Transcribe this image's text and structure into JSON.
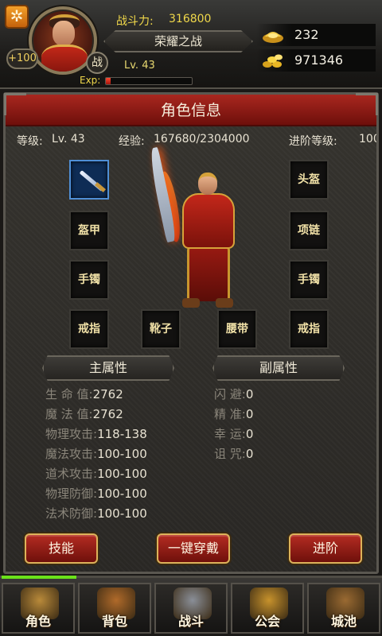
{
  "header": {
    "power_label": "战斗力:",
    "power_value": "316800",
    "title_name": "荣耀之战",
    "level": "Lv. 43",
    "level_bonus": "+100",
    "battle_badge": "战",
    "exp_label": "Exp:",
    "exp_progress": 0.06,
    "gold": "232",
    "coins": "971346",
    "settings_icon": "gear-icon",
    "gold_icon": "gold-ingot-icon",
    "coin_icon": "coin-pile-icon"
  },
  "panel": {
    "title": "角色信息",
    "level_label": "等级:",
    "level_value": "Lv. 43",
    "exp_label": "经验:",
    "exp_value": "167680/2304000",
    "advance_label": "进阶等级:",
    "advance_value": "100"
  },
  "equipment": {
    "helmet": "头盔",
    "armor": "盔甲",
    "necklace": "项链",
    "bracelet_left": "手镯",
    "bracelet_right": "手镯",
    "ring_left": "戒指",
    "boots": "靴子",
    "belt": "腰带",
    "ring_right": "戒指"
  },
  "main_attributes": {
    "title": "主属性",
    "items": [
      {
        "label": "生  命  值:",
        "value": "2762"
      },
      {
        "label": "魔  法  值:",
        "value": "2762"
      },
      {
        "label": "物理攻击:",
        "value": "118-138"
      },
      {
        "label": "魔法攻击:",
        "value": "100-100"
      },
      {
        "label": "道术攻击:",
        "value": "100-100"
      },
      {
        "label": "物理防御:",
        "value": "100-100"
      },
      {
        "label": "法术防御:",
        "value": "100-100"
      }
    ]
  },
  "sub_attributes": {
    "title": "副属性",
    "items": [
      {
        "label": "闪    避:",
        "value": "0"
      },
      {
        "label": "精    准:",
        "value": "0"
      },
      {
        "label": "幸    运:",
        "value": "0"
      },
      {
        "label": "诅    咒:",
        "value": "0"
      }
    ]
  },
  "buttons": {
    "skills": "技能",
    "equip_all": "一键穿戴",
    "advance": "进阶"
  },
  "nav": [
    {
      "label": "角色",
      "icon": "helmet-icon"
    },
    {
      "label": "背包",
      "icon": "scroll-bag-icon"
    },
    {
      "label": "战斗",
      "icon": "crossed-swords-icon"
    },
    {
      "label": "公会",
      "icon": "guild-chest-icon"
    },
    {
      "label": "城池",
      "icon": "treasure-chest-icon"
    }
  ],
  "colors": {
    "accent_red": "#a9271f",
    "gold_text": "#f0d84a",
    "nav_active": "#6ae21a"
  }
}
